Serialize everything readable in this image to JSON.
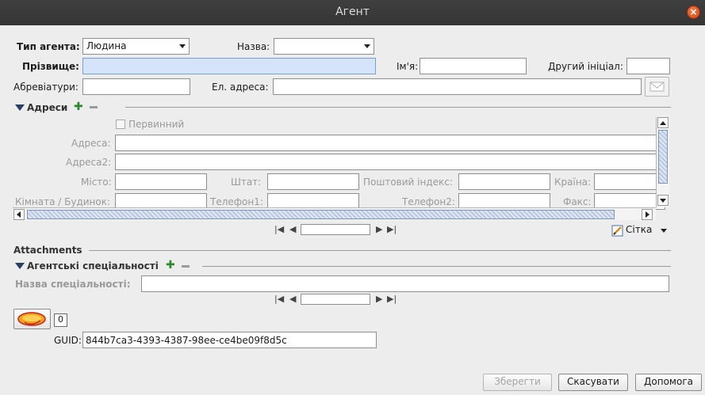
{
  "window": {
    "title": "Агент"
  },
  "agent": {
    "type_label": "Тип агента:",
    "type_value": "Людина",
    "name_label": "Назва:",
    "name_value": "",
    "surname_label": "Прізвище:",
    "surname_value": "",
    "firstname_label": "Ім'я:",
    "firstname_value": "",
    "middle_label": "Другий ініціал:",
    "middle_value": "",
    "abbr_label": "Абревіатури:",
    "abbr_value": "",
    "email_label": "Ел. адреса:",
    "email_value": ""
  },
  "addresses": {
    "title": "Адреси",
    "primary_label": "Первинний",
    "address_label": "Адреса:",
    "address2_label": "Адреса2:",
    "city_label": "Місто:",
    "state_label": "Штат:",
    "postal_label": "Поштовий індекс:",
    "country_label": "Країна:",
    "room_label": "Кімната / Будинок:",
    "phone1_label": "Телефон1:",
    "phone2_label": "Телефон2:",
    "fax_label": "Факс:",
    "view_label": "Сітка"
  },
  "attachments": {
    "title": "Attachments"
  },
  "specialties": {
    "title": "Агентські спеціальності",
    "name_label": "Назва спеціальності:",
    "name_value": ""
  },
  "attach_count": "0",
  "guid": {
    "label": "GUID:",
    "value": "844b7ca3-4393-4387-98ee-ce4be09f8d5c"
  },
  "buttons": {
    "save": "Зберегти",
    "cancel": "Скасувати",
    "help": "Допомога"
  },
  "colors": {
    "accent_green": "#2c8a2c",
    "highlight_field": "#d6e4fb",
    "close": "#e35a25"
  }
}
